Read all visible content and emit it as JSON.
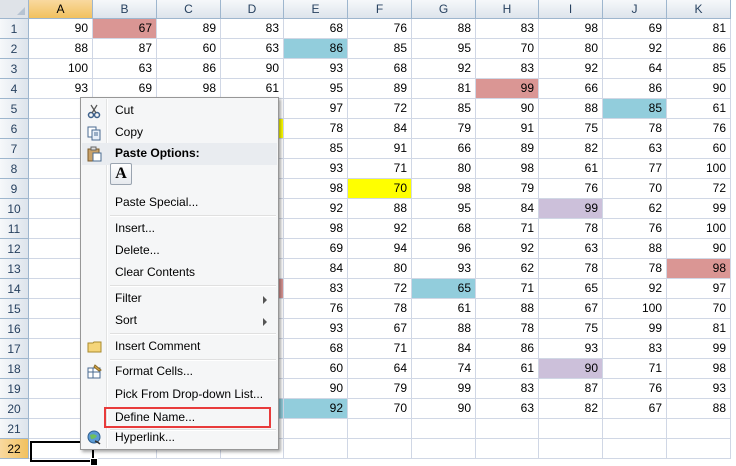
{
  "columns": [
    "A",
    "B",
    "C",
    "D",
    "E",
    "F",
    "G",
    "H",
    "I",
    "J",
    "K"
  ],
  "rows": [
    1,
    2,
    3,
    4,
    5,
    6,
    7,
    8,
    9,
    10,
    11,
    12,
    13,
    14,
    15,
    16,
    17,
    18,
    19,
    20,
    21,
    22
  ],
  "active_cell": "A22",
  "highlight_colors": {
    "red": "#da9694",
    "blue": "#92cddc",
    "yellow": "#ffff00",
    "purple": "#ccc0da"
  },
  "cells": [
    [
      "90",
      "67",
      "89",
      "83",
      "68",
      "76",
      "88",
      "83",
      "98",
      "69",
      "81"
    ],
    [
      "88",
      "87",
      "60",
      "63",
      "86",
      "85",
      "95",
      "70",
      "80",
      "92",
      "86"
    ],
    [
      "100",
      "63",
      "86",
      "90",
      "93",
      "68",
      "92",
      "83",
      "92",
      "64",
      "85"
    ],
    [
      "93",
      "69",
      "98",
      "61",
      "95",
      "89",
      "81",
      "99",
      "66",
      "86",
      "90"
    ],
    [
      "",
      "",
      "",
      "",
      "97",
      "72",
      "85",
      "90",
      "88",
      "85",
      "61"
    ],
    [
      "",
      "",
      "",
      "",
      "78",
      "84",
      "79",
      "91",
      "75",
      "78",
      "76"
    ],
    [
      "",
      "",
      "",
      "",
      "85",
      "91",
      "66",
      "89",
      "82",
      "63",
      "60"
    ],
    [
      "",
      "",
      "",
      "",
      "93",
      "71",
      "80",
      "98",
      "61",
      "77",
      "100"
    ],
    [
      "",
      "",
      "",
      "",
      "98",
      "70",
      "98",
      "79",
      "76",
      "70",
      "72"
    ],
    [
      "",
      "",
      "",
      "",
      "92",
      "88",
      "95",
      "84",
      "99",
      "62",
      "99"
    ],
    [
      "",
      "",
      "",
      "",
      "98",
      "92",
      "68",
      "71",
      "78",
      "76",
      "100"
    ],
    [
      "",
      "",
      "",
      "",
      "69",
      "94",
      "96",
      "92",
      "63",
      "88",
      "90"
    ],
    [
      "",
      "",
      "",
      "",
      "84",
      "80",
      "93",
      "62",
      "78",
      "78",
      "98"
    ],
    [
      "",
      "",
      "",
      "",
      "83",
      "72",
      "65",
      "71",
      "65",
      "92",
      "97"
    ],
    [
      "",
      "",
      "",
      "",
      "76",
      "78",
      "61",
      "88",
      "67",
      "100",
      "70"
    ],
    [
      "",
      "",
      "",
      "",
      "93",
      "67",
      "88",
      "78",
      "75",
      "99",
      "81"
    ],
    [
      "",
      "",
      "",
      "",
      "68",
      "71",
      "84",
      "86",
      "93",
      "83",
      "99"
    ],
    [
      "",
      "",
      "",
      "",
      "60",
      "64",
      "74",
      "61",
      "90",
      "71",
      "98"
    ],
    [
      "",
      "",
      "",
      "",
      "90",
      "79",
      "99",
      "83",
      "87",
      "76",
      "93"
    ],
    [
      "",
      "",
      "",
      "",
      "92",
      "70",
      "90",
      "63",
      "82",
      "67",
      "88"
    ],
    [
      "",
      "",
      "",
      "",
      "",
      "",
      "",
      "",
      "",
      "",
      ""
    ],
    [
      "",
      "",
      "",
      "",
      "",
      "",
      "",
      "",
      "",
      "",
      ""
    ]
  ],
  "cell_fills": [
    {
      "row": 1,
      "col": "B",
      "color": "red"
    },
    {
      "row": 2,
      "col": "E",
      "color": "blue"
    },
    {
      "row": 4,
      "col": "H",
      "color": "red"
    },
    {
      "row": 5,
      "col": "J",
      "color": "blue"
    },
    {
      "row": 6,
      "col": "D",
      "color": "yellow"
    },
    {
      "row": 9,
      "col": "F",
      "color": "yellow"
    },
    {
      "row": 10,
      "col": "I",
      "color": "purple"
    },
    {
      "row": 13,
      "col": "K",
      "color": "red"
    },
    {
      "row": 14,
      "col": "D",
      "color": "red"
    },
    {
      "row": 14,
      "col": "G",
      "color": "blue"
    },
    {
      "row": 18,
      "col": "I",
      "color": "purple"
    },
    {
      "row": 20,
      "col": "D",
      "color": "blue"
    },
    {
      "row": 20,
      "col": "E",
      "color": "blue"
    }
  ],
  "context_menu": {
    "cut": "Cut",
    "copy": "Copy",
    "paste_options": "Paste Options:",
    "paste_glyph": "A",
    "paste_special": "Paste Special...",
    "insert": "Insert...",
    "delete": "Delete...",
    "clear_contents": "Clear Contents",
    "filter": "Filter",
    "sort": "Sort",
    "insert_comment": "Insert Comment",
    "format_cells": "Format Cells...",
    "pick_from_list": "Pick From Drop-down List...",
    "define_name": "Define Name...",
    "hyperlink": "Hyperlink..."
  },
  "annotation_color": "#e83b3b"
}
